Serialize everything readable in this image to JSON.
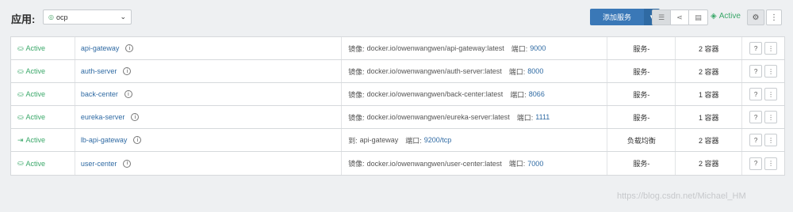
{
  "header": {
    "app_label": "应用:",
    "stack_selector": {
      "icon": "stack-dot-icon",
      "value": "ocp"
    },
    "add_service_label": "添加服务",
    "state_label": "Active",
    "colors": {
      "primary": "#3a78b7",
      "active": "#3ba86a"
    }
  },
  "services": [
    {
      "state": "Active",
      "state_icon": "service-icon",
      "name": "api-gateway",
      "detail_label": "镜像:",
      "detail_value": "docker.io/owenwangwen/api-gateway:latest",
      "port_label": "端口:",
      "port": "9000",
      "type": "服务-",
      "scale": "2 容器"
    },
    {
      "state": "Active",
      "state_icon": "service-icon",
      "name": "auth-server",
      "detail_label": "镜像:",
      "detail_value": "docker.io/owenwangwen/auth-server:latest",
      "port_label": "端口:",
      "port": "8000",
      "type": "服务-",
      "scale": "2 容器"
    },
    {
      "state": "Active",
      "state_icon": "service-icon",
      "name": "back-center",
      "detail_label": "镜像:",
      "detail_value": "docker.io/owenwangwen/back-center:latest",
      "port_label": "端口:",
      "port": "8066",
      "type": "服务-",
      "scale": "1 容器"
    },
    {
      "state": "Active",
      "state_icon": "service-icon",
      "name": "eureka-server",
      "detail_label": "镜像:",
      "detail_value": "docker.io/owenwangwen/eureka-server:latest",
      "port_label": "端口:",
      "port": "1111",
      "type": "服务-",
      "scale": "1 容器"
    },
    {
      "state": "Active",
      "state_icon": "load-balancer-icon",
      "name": "lb-api-gateway",
      "detail_label": "到:",
      "detail_value": "api-gateway",
      "port_label": "端口:",
      "port": "9200/tcp",
      "type": "负载均衡",
      "scale": "2 容器"
    },
    {
      "state": "Active",
      "state_icon": "service-icon",
      "name": "user-center",
      "detail_label": "镜像:",
      "detail_value": "docker.io/owenwangwen/user-center:latest",
      "port_label": "端口:",
      "port": "7000",
      "type": "服务-",
      "scale": "2 容器"
    }
  ],
  "watermark": "https://blog.csdn.net/Michael_HM"
}
